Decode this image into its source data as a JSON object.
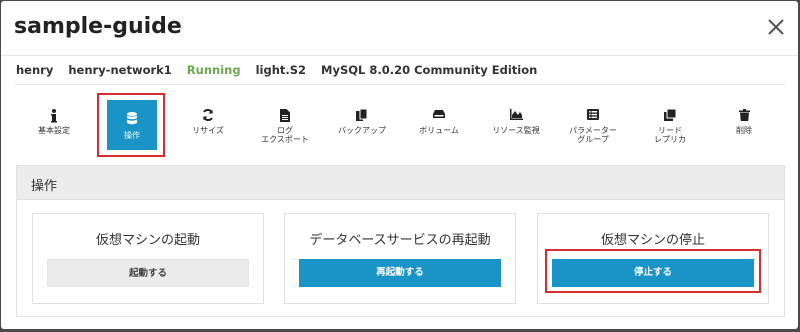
{
  "dialog": {
    "title": "sample-guide",
    "close_icon": "close-icon"
  },
  "info": {
    "user": "henry",
    "network": "henry-network1",
    "status": "Running",
    "plan": "light.S2",
    "database": "MySQL 8.0.20 Community Edition"
  },
  "colors": {
    "accent": "#1a94c6",
    "running": "#6aa84f",
    "highlight": "#d32f2f"
  },
  "toolbar": {
    "items": [
      {
        "label": "基本設定",
        "icon": "info-icon"
      },
      {
        "label": "操作",
        "icon": "database-icon",
        "active": true
      },
      {
        "label": "リサイズ",
        "icon": "refresh-icon"
      },
      {
        "label_line1": "ログ",
        "label_line2": "エクスポート",
        "icon": "file-icon"
      },
      {
        "label": "バックアップ",
        "icon": "copy-icon"
      },
      {
        "label": "ボリューム",
        "icon": "hdd-icon"
      },
      {
        "label": "リソース監視",
        "icon": "area-chart-icon"
      },
      {
        "label_line1": "パラメーター",
        "label_line2": "グループ",
        "icon": "list-icon"
      },
      {
        "label_line1": "リード",
        "label_line2": "レプリカ",
        "icon": "clone-icon"
      },
      {
        "label": "削除",
        "icon": "trash-icon"
      }
    ]
  },
  "panel": {
    "title": "操作",
    "cards": [
      {
        "title": "仮想マシンの起動",
        "button": "起動する"
      },
      {
        "title": "データベースサービスの再起動",
        "button": "再起動する"
      },
      {
        "title": "仮想マシンの停止",
        "button": "停止する"
      }
    ]
  }
}
